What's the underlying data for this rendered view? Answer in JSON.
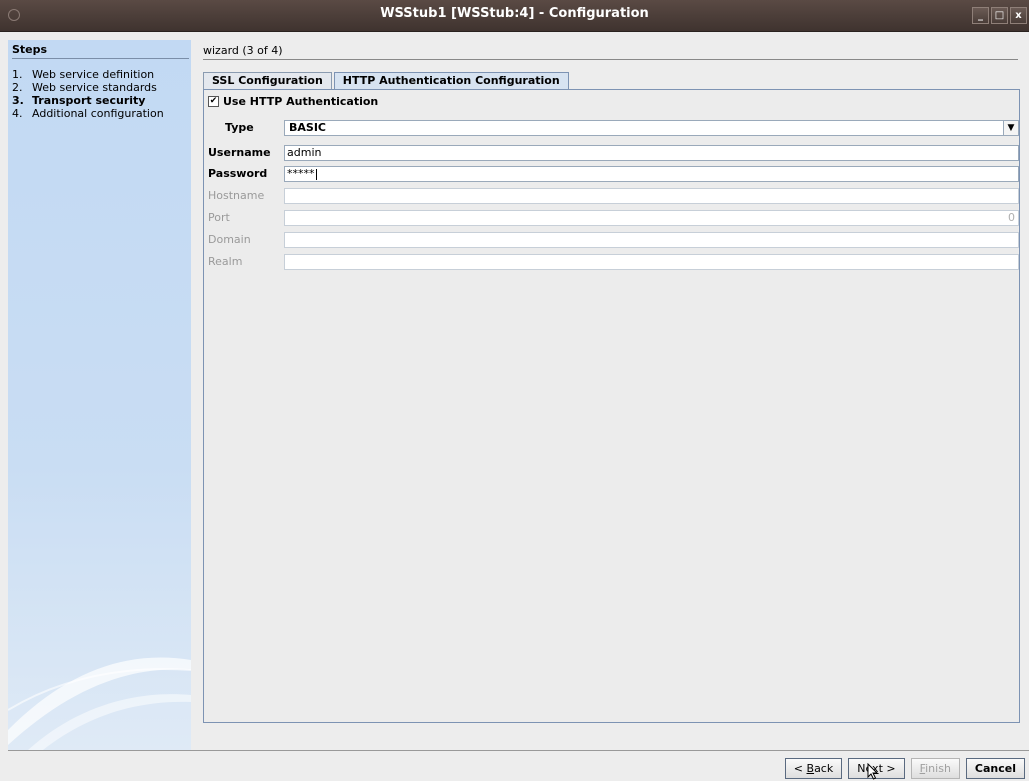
{
  "window": {
    "title": "WSStub1 [WSStub:4] - Configuration",
    "minimize": "_",
    "maximize": "□",
    "close": "x"
  },
  "steps": {
    "title": "Steps",
    "items": [
      {
        "num": "1.",
        "label": "Web service definition"
      },
      {
        "num": "2.",
        "label": "Web service standards"
      },
      {
        "num": "3.",
        "label": "Transport security"
      },
      {
        "num": "4.",
        "label": "Additional configuration"
      }
    ],
    "active_index": 2
  },
  "wizard": {
    "header": "wizard (3 of 4)"
  },
  "tabs": [
    {
      "label": "SSL Configuration"
    },
    {
      "label": "HTTP Authentication Configuration"
    }
  ],
  "form": {
    "use_auth_label": "Use HTTP Authentication",
    "use_auth_checked": true,
    "check_glyph": "✔",
    "type_label": "Type",
    "type_value": "BASIC",
    "dropdown_arrow": "▼",
    "username_label": "Username",
    "username_value": "admin",
    "password_label": "Password",
    "password_value": "*****",
    "hostname_label": "Hostname",
    "hostname_value": "",
    "port_label": "Port",
    "port_value": "0",
    "domain_label": "Domain",
    "domain_value": "",
    "realm_label": "Realm",
    "realm_value": ""
  },
  "buttons": {
    "back_prefix": "< ",
    "back_key": "B",
    "back_rest": "ack",
    "next_prefix": "Ne",
    "next_key": "x",
    "next_rest": "t >",
    "finish_key": "F",
    "finish_rest": "inish",
    "cancel": "Cancel"
  }
}
